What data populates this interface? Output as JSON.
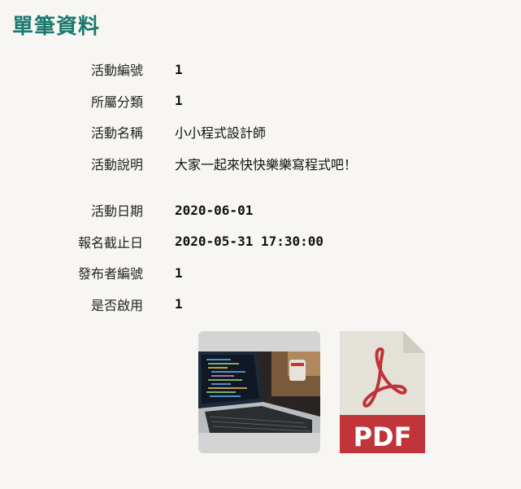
{
  "page": {
    "title": "單筆資料"
  },
  "fields": [
    {
      "label": "活動編號",
      "value": "1"
    },
    {
      "label": "所屬分類",
      "value": "1"
    },
    {
      "label": "活動名稱",
      "value": "小小程式設計師"
    },
    {
      "label": "活動說明",
      "value": "大家一起來快快樂樂寫程式吧！"
    },
    {
      "label": "活動日期",
      "value": "2020-06-01"
    },
    {
      "label": "報名截止日",
      "value": "2020-05-31 17:30:00"
    },
    {
      "label": "發布者編號",
      "value": "1"
    },
    {
      "label": "是否啟用",
      "value": "1"
    }
  ],
  "attachments": {
    "photo_icon": "laptop-photo",
    "file_icon": "pdf-icon",
    "file_type_text": "PDF"
  },
  "colors": {
    "title": "#1a7a6e",
    "background": "#f7f6f2",
    "pdf_red": "#c0343a",
    "pdf_paper": "#e4e2d8"
  }
}
